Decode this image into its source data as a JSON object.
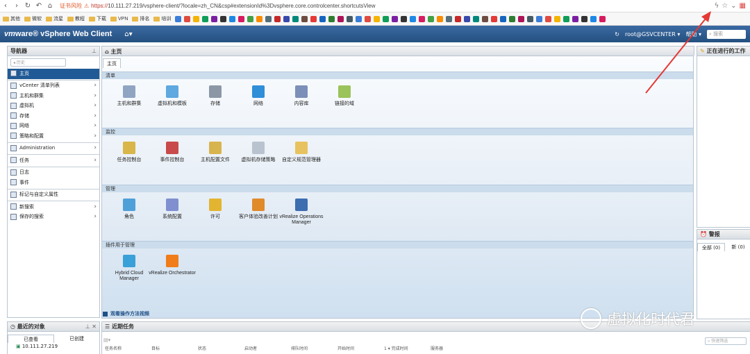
{
  "browser": {
    "warning": "证书风险",
    "url_scheme": "https://",
    "url_rest": "10.111.27.219/vsphere-client/?locale=zh_CN&csp#extensionId%3Dvsphere.core.controlcenter.shortcutsView",
    "bookmarks": [
      "其他",
      "微软",
      "流星",
      "教程",
      "下载",
      "VPN",
      "排名",
      "培训"
    ]
  },
  "header": {
    "brand_vm": "vm",
    "brand_rest": "ware® vSphere Web Client",
    "user": "root@GSVCENTER ▾",
    "help": "帮助 ▾",
    "search_placeholder": "搜索"
  },
  "navigator": {
    "title": "导航器",
    "history_btn": "◂ 历史",
    "items": [
      {
        "label": "主页",
        "selected": true
      },
      {
        "label": "vCenter 清单列表",
        "chev": true
      },
      {
        "label": "主机和群集",
        "chev": true
      },
      {
        "label": "虚拟机",
        "chev": true
      },
      {
        "label": "存储",
        "chev": true
      },
      {
        "label": "网络",
        "chev": true
      },
      {
        "label": "策略和配置",
        "chev": true
      },
      {
        "label": "Administration",
        "chev": true
      },
      {
        "label": "任务",
        "chev": true
      },
      {
        "label": "日志"
      },
      {
        "label": "事件"
      },
      {
        "label": "标记与自定义属性",
        "chev": false
      },
      {
        "label": "新搜索",
        "chev": true
      },
      {
        "label": "保存的搜索",
        "chev": true
      }
    ]
  },
  "main": {
    "pane_title": "主页",
    "tab": "主页",
    "sections": [
      {
        "title": "清单",
        "tiles": [
          "主机和群集",
          "虚拟机和模板",
          "存储",
          "网络",
          "内容库",
          "链接的域"
        ]
      },
      {
        "title": "监控",
        "tiles": [
          "任务控制台",
          "事件控制台",
          "主机配置文件",
          "虚拟机存储策略",
          "自定义规范管理器"
        ]
      },
      {
        "title": "管理",
        "tiles": [
          "角色",
          "系统配置",
          "许可",
          "客户体验改善计划",
          "vRealize Operations Manager"
        ]
      },
      {
        "title": "插件用于管理",
        "tiles": [
          "Hybrid Cloud Manager",
          "vRealize Orchestrator"
        ]
      }
    ],
    "video_link": "观看操作方法视频"
  },
  "right": {
    "work_title": "正在进行的工作",
    "alarm_title": "警报",
    "alarm_tabs": [
      "全部 (0)",
      "新 (0)"
    ]
  },
  "recent": {
    "title": "最近的对象",
    "tabs": [
      "已查看",
      "已创建"
    ],
    "item": "10.111.27.219"
  },
  "tasks": {
    "title": "近期任务",
    "filter_placeholder": "快速筛选",
    "columns": [
      "任务名称",
      "目标",
      "状态",
      "启动者",
      "排队时间",
      "开始时间",
      "1 ▾ 完成时间",
      "服务器"
    ]
  },
  "watermark": "虚拟化时代君"
}
